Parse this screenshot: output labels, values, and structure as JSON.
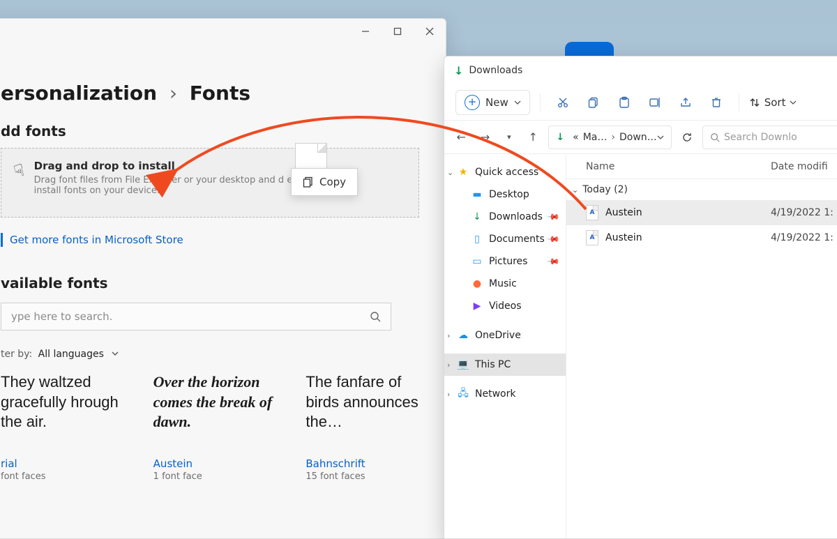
{
  "settings": {
    "breadcrumb_parent": "ersonalization",
    "breadcrumb_sep": "›",
    "breadcrumb_current": "Fonts",
    "add_fonts_heading": "dd fonts",
    "dropzone": {
      "title": "Drag and drop to install",
      "subtitle": "Drag font files from File Explorer or your desktop and d           e to install fonts on your device."
    },
    "copy_bubble": "Copy",
    "store_link": "Get more fonts in Microsoft Store",
    "available_heading": "vailable fonts",
    "search_placeholder": "ype here to search.",
    "filter_label": "ter by:",
    "filter_value": "All languages",
    "fonts": [
      {
        "sample": "They waltzed gracefully hrough the air.",
        "name": "rial",
        "faces": " font faces"
      },
      {
        "sample": "Over the horizon comes the break of dawn.",
        "name": "Austein",
        "faces": "1 font face"
      },
      {
        "sample": "The fanfare of birds announces the…",
        "name": "Bahnschrift",
        "faces": "15 font faces"
      }
    ]
  },
  "explorer": {
    "title": "Downloads",
    "toolbar": {
      "new": "New",
      "sort": "Sort"
    },
    "address": {
      "root": "Ma…",
      "current": "Down…"
    },
    "search_placeholder": "Search Downlo",
    "nav": {
      "quick_access": "Quick access",
      "desktop": "Desktop",
      "downloads": "Downloads",
      "documents": "Documents",
      "pictures": "Pictures",
      "music": "Music",
      "videos": "Videos",
      "onedrive": "OneDrive",
      "this_pc": "This PC",
      "network": "Network"
    },
    "columns": {
      "name": "Name",
      "date": "Date modifi"
    },
    "group": "Today (2)",
    "files": [
      {
        "name": "Austein",
        "date": "4/19/2022 1:"
      },
      {
        "name": "Austein",
        "date": "4/19/2022 1:"
      }
    ]
  }
}
